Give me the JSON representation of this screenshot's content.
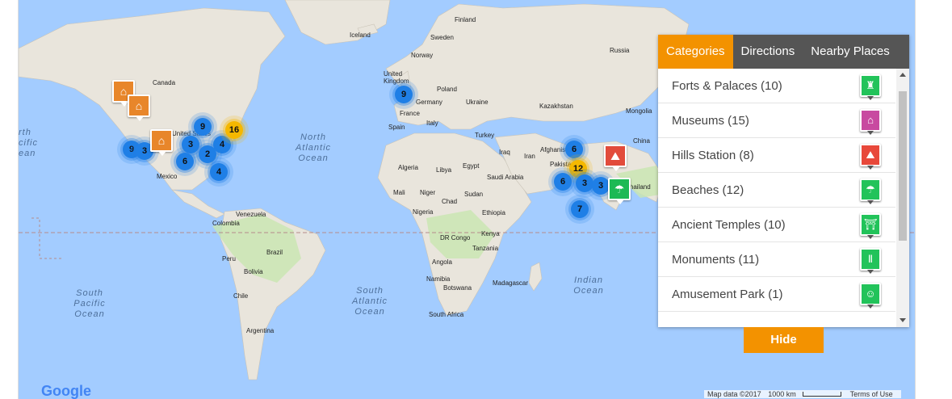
{
  "map": {
    "countries": [
      {
        "name": "Finland"
      },
      {
        "name": "Sweden"
      },
      {
        "name": "Iceland"
      },
      {
        "name": "Norway"
      },
      {
        "name": "Russia"
      },
      {
        "name": "United Kingdom"
      },
      {
        "name": "Poland"
      },
      {
        "name": "Germany"
      },
      {
        "name": "Ukraine"
      },
      {
        "name": "France"
      },
      {
        "name": "Italy"
      },
      {
        "name": "Spain"
      },
      {
        "name": "Kazakhstan"
      },
      {
        "name": "Mongolia"
      },
      {
        "name": "China"
      },
      {
        "name": "Turkey"
      },
      {
        "name": "Iraq"
      },
      {
        "name": "Iran"
      },
      {
        "name": "Afghanistan"
      },
      {
        "name": "Pakistan"
      },
      {
        "name": "Saudi Arabia"
      },
      {
        "name": "Egypt"
      },
      {
        "name": "Algeria"
      },
      {
        "name": "Libya"
      },
      {
        "name": "Mali"
      },
      {
        "name": "Niger"
      },
      {
        "name": "Chad"
      },
      {
        "name": "Sudan"
      },
      {
        "name": "Nigeria"
      },
      {
        "name": "Ethiopia"
      },
      {
        "name": "DR Congo"
      },
      {
        "name": "Kenya"
      },
      {
        "name": "Tanzania"
      },
      {
        "name": "Angola"
      },
      {
        "name": "Namibia"
      },
      {
        "name": "Botswana"
      },
      {
        "name": "Madagascar"
      },
      {
        "name": "South Africa"
      },
      {
        "name": "Canada"
      },
      {
        "name": "United States"
      },
      {
        "name": "Mexico"
      },
      {
        "name": "Venezuela"
      },
      {
        "name": "Colombia"
      },
      {
        "name": "Brazil"
      },
      {
        "name": "Peru"
      },
      {
        "name": "Bolivia"
      },
      {
        "name": "Chile"
      },
      {
        "name": "Argentina"
      },
      {
        "name": "Thailand"
      }
    ],
    "oceans": [
      {
        "line1": "North",
        "line2": "Atlantic",
        "line3": "Ocean"
      },
      {
        "line1": "South",
        "line2": "Atlantic",
        "line3": "Ocean"
      },
      {
        "line1": "South",
        "line2": "Pacific",
        "line3": "Ocean"
      },
      {
        "line1": "Indian",
        "line2": "Ocean",
        "line3": ""
      },
      {
        "line1": "rth",
        "line2": "cific",
        "line3": "ean"
      }
    ],
    "clusters": [
      {
        "count": "9",
        "color": "blue"
      },
      {
        "count": "3",
        "color": "blue"
      },
      {
        "count": "9",
        "color": "blue"
      },
      {
        "count": "3",
        "color": "blue"
      },
      {
        "count": "4",
        "color": "blue"
      },
      {
        "count": "2",
        "color": "blue"
      },
      {
        "count": "6",
        "color": "blue"
      },
      {
        "count": "4",
        "color": "blue"
      },
      {
        "count": "16",
        "color": "orange"
      },
      {
        "count": "9",
        "color": "blue"
      },
      {
        "count": "6",
        "color": "blue"
      },
      {
        "count": "12",
        "color": "orange"
      },
      {
        "count": "6",
        "color": "blue"
      },
      {
        "count": "3",
        "color": "blue"
      },
      {
        "count": "3",
        "color": "blue"
      },
      {
        "count": "7",
        "color": "blue"
      }
    ],
    "pins": [
      {
        "icon": "museum-icon",
        "color": "#e8862a"
      },
      {
        "icon": "museum-icon",
        "color": "#e8862a"
      },
      {
        "icon": "museum-icon",
        "color": "#e8862a"
      },
      {
        "icon": "hills-icon",
        "color": "#e24b3b"
      },
      {
        "icon": "beach-icon",
        "color": "#1db954"
      }
    ]
  },
  "panel": {
    "tabs": [
      {
        "label": "Categories",
        "active": true
      },
      {
        "label": "Directions",
        "active": false
      },
      {
        "label": "Nearby Places",
        "active": false
      }
    ],
    "categories": [
      {
        "label": "Forts & Palaces (10)",
        "color": "#22c35a",
        "icon": "fort-icon",
        "glyph": "♜"
      },
      {
        "label": "Museums (15)",
        "color": "#c84aa0",
        "icon": "museum-icon",
        "glyph": "🏛"
      },
      {
        "label": "Hills Station (8)",
        "color": "#e8483a",
        "icon": "hills-icon",
        "glyph": "⛰"
      },
      {
        "label": "Beaches (12)",
        "color": "#22c35a",
        "icon": "beach-icon",
        "glyph": "☂"
      },
      {
        "label": "Ancient Temples (10)",
        "color": "#22c35a",
        "icon": "temple-icon",
        "glyph": "⛩"
      },
      {
        "label": "Monuments (11)",
        "color": "#22c35a",
        "icon": "monument-icon",
        "glyph": "⚲"
      },
      {
        "label": "Amusement Park (1)",
        "color": "#22c35a",
        "icon": "amusement-park-icon",
        "glyph": "☺"
      }
    ],
    "hide_label": "Hide"
  },
  "footer": {
    "google": "Google",
    "map_data": "Map data ©2017",
    "scale": "1000 km",
    "terms": "Terms of Use"
  }
}
